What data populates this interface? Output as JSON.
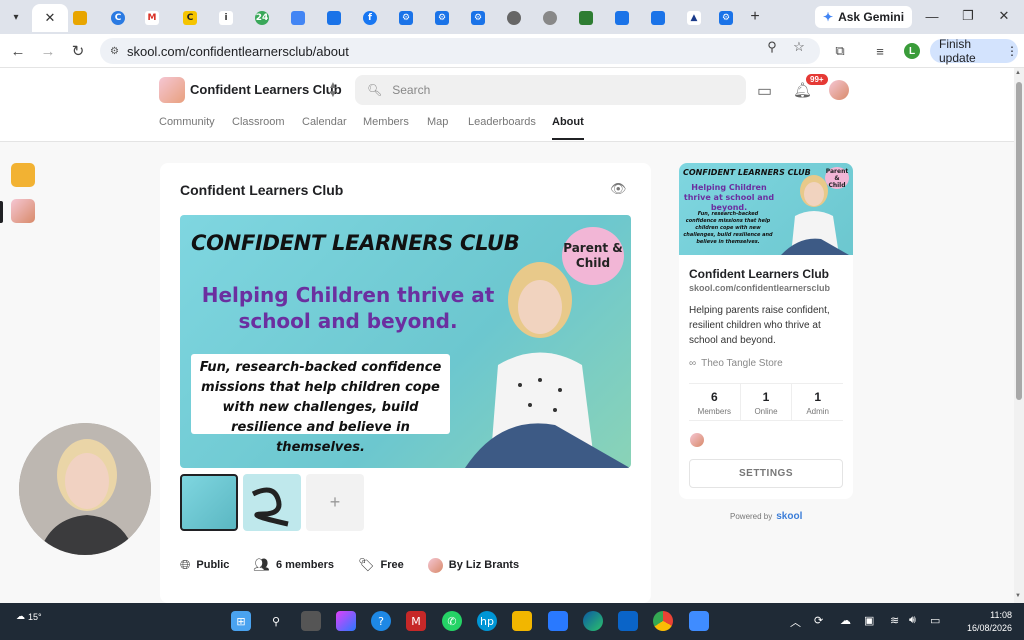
{
  "browser": {
    "url": "skool.com/confidentlearnersclub/about",
    "ask_gemini": "Ask Gemini",
    "finish_update": "Finish update",
    "profile_initial": "L",
    "new_tab": "+"
  },
  "skool": {
    "group_name": "Confident Learners Club",
    "search_placeholder": "Search",
    "notification_count": "99+",
    "nav_tabs": [
      "Community",
      "Classroom",
      "Calendar",
      "Members",
      "Map",
      "Leaderboards",
      "About"
    ],
    "active_tab": "About"
  },
  "main": {
    "title": "Confident Learners Club",
    "banner": {
      "heading": "CONFIDENT LEARNERS CLUB",
      "subheading": "Helping Children thrive at school and beyond.",
      "body": "Fun, research-backed confidence missions that help children cope with new challenges, build resilience and believe in themselves.",
      "badge": "Parent & Child"
    },
    "thumb_add": "+",
    "meta": {
      "privacy": "Public",
      "members": "6 members",
      "price": "Free",
      "owner": "By Liz Brants"
    }
  },
  "sidebar": {
    "name": "Confident Learners Club",
    "url": "skool.com/confidentlearnersclub",
    "description": "Helping parents raise confident, resilient children who thrive at school and beyond.",
    "link_label": "Theo Tangle Store",
    "stats": [
      {
        "value": "6",
        "label": "Members"
      },
      {
        "value": "1",
        "label": "Online"
      },
      {
        "value": "1",
        "label": "Admin"
      }
    ],
    "settings_label": "SETTINGS",
    "powered_by": "Powered by",
    "powered_logo": "skool"
  },
  "taskbar": {
    "temperature": "15°",
    "time": "11:08",
    "date": "16/08/2026"
  },
  "colors": {
    "accent_purple": "#6b2fa0",
    "banner_teal": "#7fd6e0",
    "badge_pink": "#f2b6d6",
    "notif_red": "#e53935"
  }
}
